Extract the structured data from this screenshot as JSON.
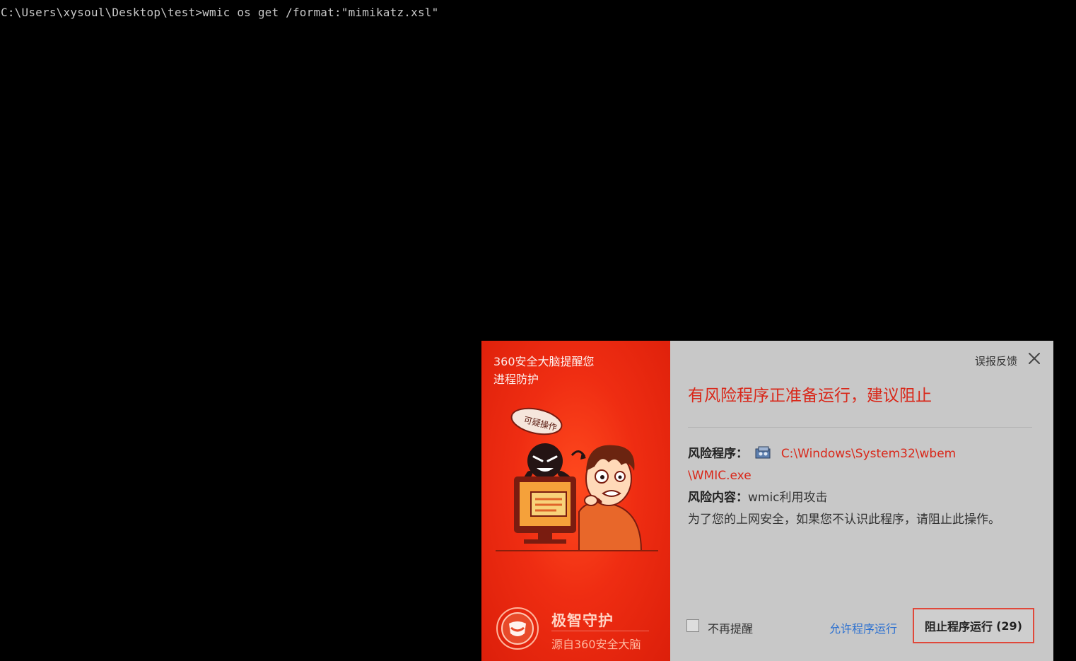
{
  "console": {
    "command_line": "C:\\Users\\xysoul\\Desktop\\test>wmic os get /format:\"mimikatz.xsl\""
  },
  "popup": {
    "left": {
      "header_line1": "360安全大脑提醒您",
      "header_line2": "进程防护",
      "speech_bubble": "可疑操作",
      "brand_title": "极智守护",
      "brand_sub": "源自360安全大脑"
    },
    "right": {
      "feedback_link": "误报反馈",
      "alert_title": "有风险程序正准备运行，建议阻止",
      "risk_program_label": "风险程序：",
      "risk_program_path_line1": "C:\\Windows\\System32\\wbem",
      "risk_program_path_line2": "\\WMIC.exe",
      "risk_content_label": "风险内容：",
      "risk_content_value": "wmic利用攻击",
      "advice": "为了您的上网安全，如果您不认识此程序，请阻止此操作。",
      "dont_remind_label": "不再提醒",
      "allow_link": "允许程序运行",
      "block_button": "阻止程序运行",
      "block_countdown": "(29)"
    }
  },
  "colors": {
    "console_bg": "#000000",
    "console_text": "#c7c7c7",
    "popup_red": "#e42a12",
    "alert_red": "#d9281a",
    "link_blue": "#2a6fd0",
    "panel_gray": "#c8c8c8"
  },
  "icons": {
    "close": "close-icon",
    "file": "wmic-file-icon",
    "shield": "shield-logo-icon",
    "checkbox": "checkbox-unchecked"
  }
}
